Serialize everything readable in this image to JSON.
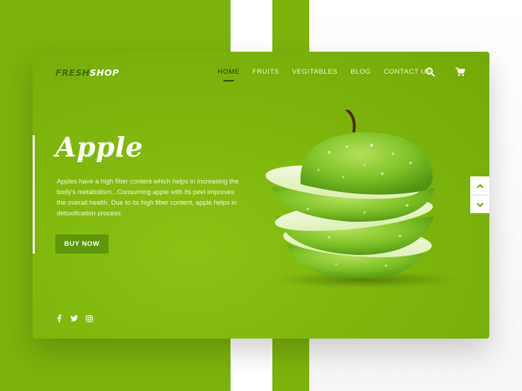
{
  "brand": {
    "logo_part1": "FRESH",
    "logo_part2": "SHOP"
  },
  "nav": {
    "items": [
      {
        "label": "HOME",
        "active": true
      },
      {
        "label": "FRUITS"
      },
      {
        "label": "VEGITABLES"
      },
      {
        "label": "BLOG"
      },
      {
        "label": "CONTACT US"
      }
    ]
  },
  "hero": {
    "title": "Apple",
    "description": "Apples have a high fiber content which helps in increasing the body's metabolism...Consuming apple with its peel improves the overall health. Due to its high fiber content, apple helps in detoxification process.",
    "cta_label": "BUY NOW"
  },
  "icons": {
    "search": "search-icon",
    "cart": "cart-icon",
    "social": [
      "facebook-icon",
      "twitter-icon",
      "instagram-icon"
    ],
    "scroll_up": "chevron-up-icon",
    "scroll_down": "chevron-down-icon"
  },
  "colors": {
    "accent": "#7bb20c",
    "button": "#5f970a",
    "nav_active": "#1f3205",
    "logo_dark": "#3f6b08"
  }
}
